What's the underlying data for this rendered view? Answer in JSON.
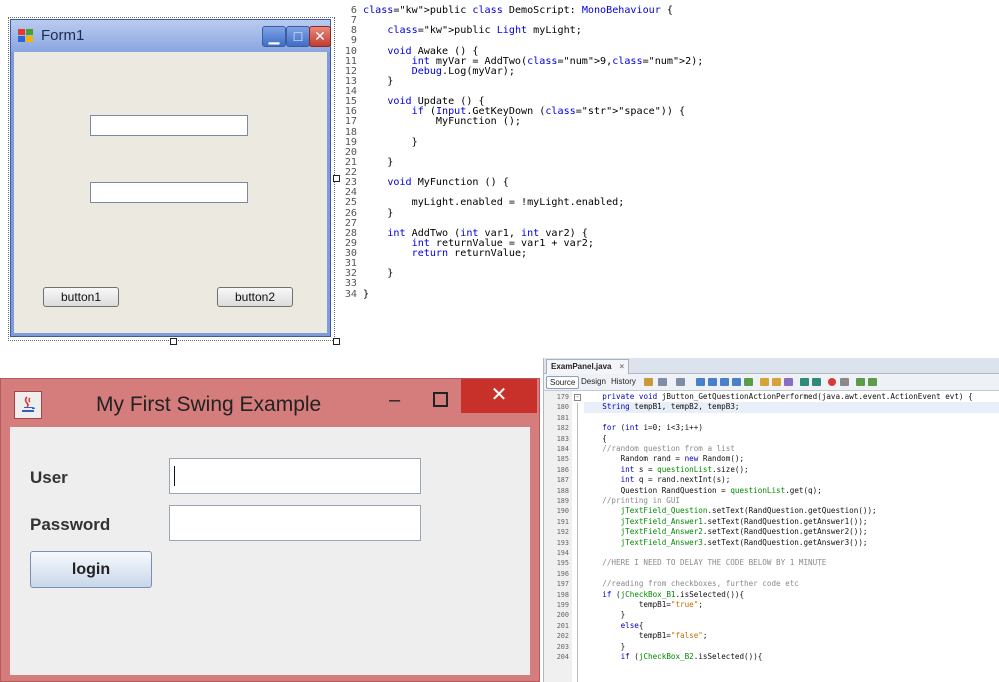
{
  "winform": {
    "title": "Form1",
    "minimize_glyph": "▁",
    "maximize_glyph": "□",
    "close_glyph": "✕",
    "button1_label": "button1",
    "button2_label": "button2"
  },
  "unity_code": {
    "lines": [
      {
        "n": "6",
        "text": "public class DemoScript: MonoBehaviour {"
      },
      {
        "n": "7",
        "text": ""
      },
      {
        "n": "8",
        "text": "    public Light myLight;"
      },
      {
        "n": "9",
        "text": ""
      },
      {
        "n": "10",
        "text": "    void Awake () {"
      },
      {
        "n": "11",
        "text": "        int myVar = AddTwo(9,2);"
      },
      {
        "n": "12",
        "text": "        Debug.Log(myVar);"
      },
      {
        "n": "13",
        "text": "    }"
      },
      {
        "n": "14",
        "text": ""
      },
      {
        "n": "15",
        "text": "    void Update () {"
      },
      {
        "n": "16",
        "text": "        if (Input.GetKeyDown (\"space\")) {"
      },
      {
        "n": "17",
        "text": "            MyFunction ();"
      },
      {
        "n": "18",
        "text": ""
      },
      {
        "n": "19",
        "text": "        }"
      },
      {
        "n": "20",
        "text": ""
      },
      {
        "n": "21",
        "text": "    }"
      },
      {
        "n": "22",
        "text": ""
      },
      {
        "n": "23",
        "text": "    void MyFunction () {"
      },
      {
        "n": "24",
        "text": ""
      },
      {
        "n": "25",
        "text": "        myLight.enabled = !myLight.enabled;"
      },
      {
        "n": "26",
        "text": "    }"
      },
      {
        "n": "27",
        "text": ""
      },
      {
        "n": "28",
        "text": "    int AddTwo (int var1, int var2) {"
      },
      {
        "n": "29",
        "text": "        int returnValue = var1 + var2;"
      },
      {
        "n": "30",
        "text": "        return returnValue;"
      },
      {
        "n": "31",
        "text": ""
      },
      {
        "n": "32",
        "text": "    }"
      },
      {
        "n": "33",
        "text": ""
      },
      {
        "n": "34",
        "text": "}"
      }
    ]
  },
  "swing": {
    "title": "My First Swing Example",
    "minimize_glyph": "–",
    "close_glyph": "✕",
    "user_label": "User",
    "password_label": "Password",
    "login_label": "login"
  },
  "netbeans": {
    "tab_label": "ExamPanel.java",
    "tab_close": "×",
    "toolbar": {
      "source": "Source",
      "design": "Design",
      "history": "History"
    },
    "lines": [
      {
        "n": "179",
        "text": "    private void jButton_GetQuestionActionPerformed(java.awt.event.ActionEvent evt) {"
      },
      {
        "n": "180",
        "text": "    String tempB1, tempB2, tempB3;"
      },
      {
        "n": "181",
        "text": ""
      },
      {
        "n": "182",
        "text": "    for (int i=0; i<3;i++)"
      },
      {
        "n": "183",
        "text": "    {"
      },
      {
        "n": "184",
        "text": "    //random question from a list"
      },
      {
        "n": "185",
        "text": "        Random rand = new Random();"
      },
      {
        "n": "186",
        "text": "        int s = questionList.size();"
      },
      {
        "n": "187",
        "text": "        int q = rand.nextInt(s);"
      },
      {
        "n": "188",
        "text": "        Question RandQuestion = questionList.get(q);"
      },
      {
        "n": "189",
        "text": "    //printing in GUI"
      },
      {
        "n": "190",
        "text": "        jTextField_Question.setText(RandQuestion.getQuestion());"
      },
      {
        "n": "191",
        "text": "        jTextField_Answer1.setText(RandQuestion.getAnswer1());"
      },
      {
        "n": "192",
        "text": "        jTextField_Answer2.setText(RandQuestion.getAnswer2());"
      },
      {
        "n": "193",
        "text": "        jTextField_Answer3.setText(RandQuestion.getAnswer3());"
      },
      {
        "n": "194",
        "text": ""
      },
      {
        "n": "195",
        "text": "    //HERE I NEED TO DELAY THE CODE BELOW BY 1 MINUTE"
      },
      {
        "n": "196",
        "text": ""
      },
      {
        "n": "197",
        "text": "    //reading from checkboxes, further code etc"
      },
      {
        "n": "198",
        "text": "    if (jCheckBox_B1.isSelected()){"
      },
      {
        "n": "199",
        "text": "            tempB1=\"true\";"
      },
      {
        "n": "200",
        "text": "        }"
      },
      {
        "n": "201",
        "text": "        else{"
      },
      {
        "n": "202",
        "text": "            tempB1=\"false\";"
      },
      {
        "n": "203",
        "text": "        }"
      },
      {
        "n": "204",
        "text": "        if (jCheckBox_B2.isSelected()){"
      }
    ]
  }
}
